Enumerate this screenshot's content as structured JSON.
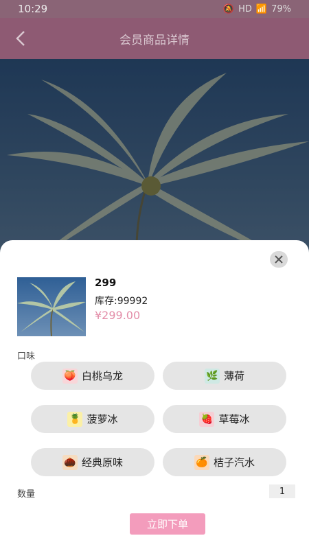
{
  "status": {
    "time": "10:29",
    "indicators": "HD",
    "battery": "79%"
  },
  "header": {
    "title": "会员商品详情"
  },
  "product": {
    "name": "299",
    "stock": "库存:99992",
    "price": "¥299.00"
  },
  "flavor": {
    "label": "口味",
    "options": [
      {
        "label": "白桃乌龙",
        "icon": "peach-icon",
        "icon_bg": "#f9d6d9"
      },
      {
        "label": "薄荷",
        "icon": "mint-icon",
        "icon_bg": "#cfe9e4"
      },
      {
        "label": "菠萝冰",
        "icon": "pineapple-icon",
        "icon_bg": "#fbf0a6"
      },
      {
        "label": "草莓冰",
        "icon": "strawberry-icon",
        "icon_bg": "#f6cfd5"
      },
      {
        "label": "经典原味",
        "icon": "classic-icon",
        "icon_bg": "#f6dcc0"
      },
      {
        "label": "桔子汽水",
        "icon": "orange-icon",
        "icon_bg": "#fbd9b9"
      }
    ]
  },
  "quantity": {
    "label": "数量",
    "value": "1"
  },
  "actions": {
    "order": "立即下单"
  },
  "colors": {
    "accent": "#f39cbc",
    "price": "#e38da8",
    "header": "#8e5a73"
  }
}
